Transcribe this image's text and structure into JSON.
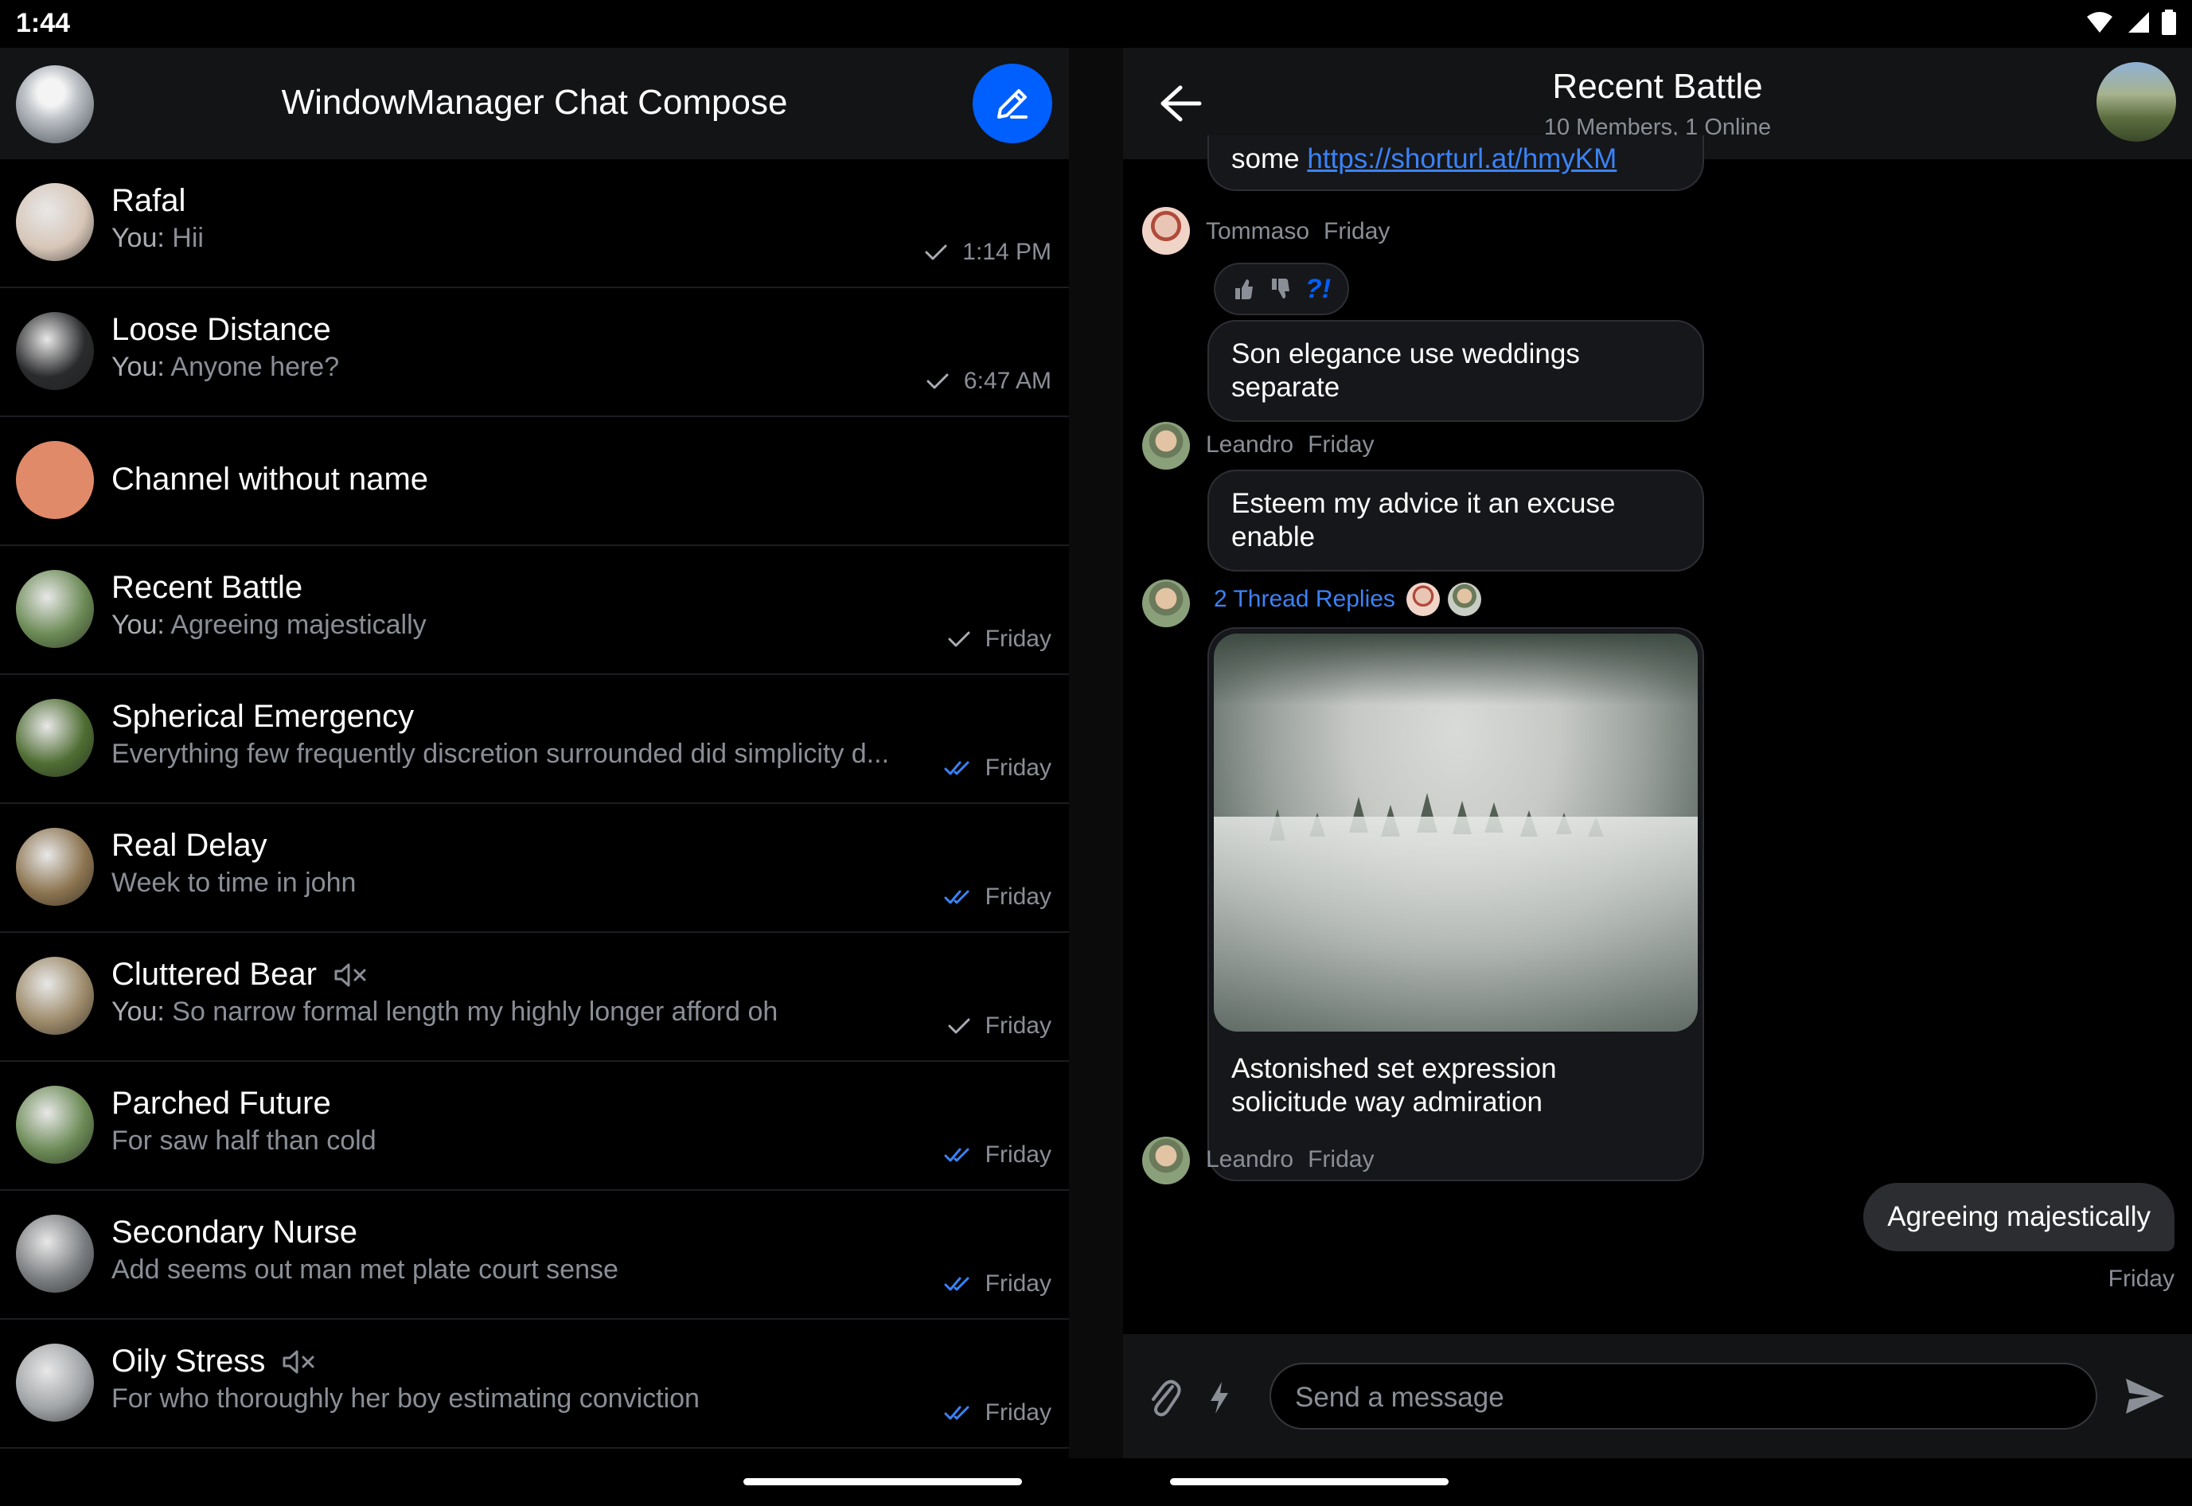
{
  "status_bar": {
    "time": "1:44"
  },
  "left_pane": {
    "title": "WindowManager Chat Compose",
    "channels": [
      {
        "name": "Rafal",
        "you_prefix": "You:",
        "preview": " Hii",
        "time": "1:14 PM",
        "read": "sent",
        "muted": false,
        "avatar_color": "#d7c6b8"
      },
      {
        "name": "Loose Distance",
        "you_prefix": "You:",
        "preview": " Anyone here?",
        "time": "6:47 AM",
        "read": "sent",
        "muted": false,
        "avatar_color": "#2a2b2d"
      },
      {
        "name": "Channel without name",
        "you_prefix": "",
        "preview": "",
        "time": "",
        "read": "",
        "muted": false,
        "avatar_color": "#e08a6a"
      },
      {
        "name": "Recent Battle",
        "you_prefix": "You:",
        "preview": " Agreeing majestically",
        "time": "Friday",
        "read": "sent",
        "muted": false,
        "avatar_color": "#6b8a55"
      },
      {
        "name": "Spherical Emergency",
        "you_prefix": "",
        "preview": "Everything few frequently discretion surrounded did simplicity d...",
        "time": "Friday",
        "read": "read",
        "muted": false,
        "avatar_color": "#4f6d33"
      },
      {
        "name": "Real Delay",
        "you_prefix": "",
        "preview": "Week to time in john",
        "time": "Friday",
        "read": "read",
        "muted": false,
        "avatar_color": "#8c7450"
      },
      {
        "name": "Cluttered Bear",
        "you_prefix": "You:",
        "preview": " So narrow formal length my highly longer afford oh",
        "time": "Friday",
        "read": "sent",
        "muted": true,
        "avatar_color": "#9d8a6a"
      },
      {
        "name": "Parched Future",
        "you_prefix": "",
        "preview": "For saw half than cold",
        "time": "Friday",
        "read": "read",
        "muted": false,
        "avatar_color": "#6b8a55"
      },
      {
        "name": "Secondary Nurse",
        "you_prefix": "",
        "preview": "Add seems out man met plate court sense",
        "time": "Friday",
        "read": "read",
        "muted": false,
        "avatar_color": "#7a7d80"
      },
      {
        "name": "Oily Stress",
        "you_prefix": "",
        "preview": "For who thoroughly her boy estimating conviction",
        "time": "Friday",
        "read": "read",
        "muted": true,
        "avatar_color": "#a0a3a6"
      }
    ]
  },
  "right_pane": {
    "title": "Recent Battle",
    "subtitle": "10 Members, 1 Online",
    "messages": {
      "partial_prefix": "some ",
      "partial_link": "https://shorturl.at/hmyKM",
      "sender1": "Tommaso",
      "day1": "Friday",
      "reaction_q": "?!",
      "msg2": "Son elegance use weddings separate",
      "sender2": "Leandro",
      "day2": "Friday",
      "msg3": "Esteem my advice it an excuse enable",
      "thread_replies": "2 Thread Replies",
      "msg4": "Astonished set expression solicitude way admiration",
      "sender4": "Leandro",
      "day4": "Friday",
      "own_msg": "Agreeing majestically",
      "own_day": "Friday"
    },
    "composer": {
      "placeholder": "Send a message"
    }
  },
  "colors": {
    "accent": "#005fff",
    "link": "#3b82f6",
    "panel": "#131416",
    "bubble": "#16171a"
  }
}
